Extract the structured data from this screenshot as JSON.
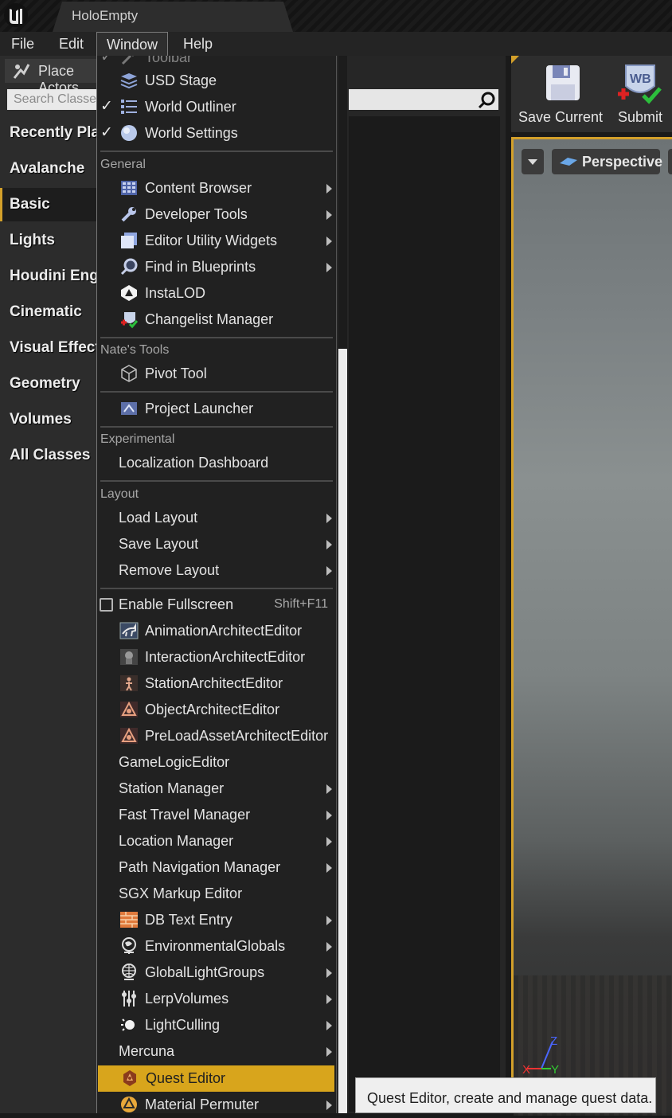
{
  "titlebar": {
    "document_tab": "HoloEmpty"
  },
  "menubar": {
    "items": [
      "File",
      "Edit",
      "Window",
      "Help"
    ]
  },
  "left_panel": {
    "tab_label": "Place Actors",
    "search_placeholder": "Search Classes",
    "categories": [
      "Recently Placed",
      "Avalanche",
      "Basic",
      "Lights",
      "Houdini Engine",
      "Cinematic",
      "Visual Effects",
      "Geometry",
      "Volumes",
      "All Classes"
    ],
    "selected": "Basic"
  },
  "toolbar": {
    "save_label": "Save Current",
    "submit_label": "Submit"
  },
  "viewport": {
    "view_mode": "Perspective",
    "axis": {
      "x": "X",
      "y": "Y",
      "z": "Z"
    }
  },
  "window_menu": {
    "top_items": [
      {
        "label": "Toolbar",
        "checked": true,
        "icon": "tools-icon"
      },
      {
        "label": "USD Stage",
        "checked": false,
        "icon": "layers-icon"
      },
      {
        "label": "World Outliner",
        "checked": true,
        "icon": "list-icon"
      },
      {
        "label": "World Settings",
        "checked": true,
        "icon": "globe-icon"
      }
    ],
    "general_header": "General",
    "general_items": [
      {
        "label": "Content Browser",
        "submenu": true,
        "icon": "grid-icon"
      },
      {
        "label": "Developer Tools",
        "submenu": true,
        "icon": "wrench-icon"
      },
      {
        "label": "Editor Utility Widgets",
        "submenu": true,
        "icon": "widget-icon"
      },
      {
        "label": "Find in Blueprints",
        "submenu": true,
        "icon": "magnifier-icon"
      },
      {
        "label": "InstaLOD",
        "submenu": false,
        "icon": "instalod-icon"
      },
      {
        "label": "Changelist Manager",
        "submenu": false,
        "icon": "changelist-icon"
      }
    ],
    "nates_header": "Nate's Tools",
    "nates_items": [
      {
        "label": "Pivot Tool",
        "icon": "cube-icon"
      }
    ],
    "launcher_item": {
      "label": "Project Launcher",
      "icon": "launcher-icon"
    },
    "experimental_header": "Experimental",
    "experimental_items": [
      {
        "label": "Localization Dashboard"
      }
    ],
    "layout_header": "Layout",
    "layout_items": [
      {
        "label": "Load Layout",
        "submenu": true
      },
      {
        "label": "Save Layout",
        "submenu": true
      },
      {
        "label": "Remove Layout",
        "submenu": true
      }
    ],
    "fullscreen": {
      "label": "Enable Fullscreen",
      "shortcut": "Shift+F11"
    },
    "custom_items": [
      {
        "label": "AnimationArchitectEditor",
        "submenu": false,
        "icon": "horse-icon"
      },
      {
        "label": "InteractionArchitectEditor",
        "submenu": false,
        "icon": "interaction-icon"
      },
      {
        "label": "StationArchitectEditor",
        "submenu": false,
        "icon": "figure-icon"
      },
      {
        "label": "ObjectArchitectEditor",
        "submenu": false,
        "icon": "object-icon"
      },
      {
        "label": "PreLoadAssetArchitectEditor",
        "submenu": false,
        "icon": "preload-icon"
      },
      {
        "label": "GameLogicEditor",
        "submenu": false,
        "icon": ""
      },
      {
        "label": "Station Manager",
        "submenu": true,
        "icon": ""
      },
      {
        "label": "Fast Travel Manager",
        "submenu": true,
        "icon": ""
      },
      {
        "label": "Location Manager",
        "submenu": true,
        "icon": ""
      },
      {
        "label": "Path Navigation Manager",
        "submenu": true,
        "icon": ""
      },
      {
        "label": "SGX Markup Editor",
        "submenu": false,
        "icon": ""
      },
      {
        "label": "DB Text Entry",
        "submenu": true,
        "icon": "brick-icon"
      },
      {
        "label": "EnvironmentalGlobals",
        "submenu": true,
        "icon": "env-globe-icon"
      },
      {
        "label": "GlobalLightGroups",
        "submenu": true,
        "icon": "light-globe-icon"
      },
      {
        "label": "LerpVolumes",
        "submenu": true,
        "icon": "sliders-icon"
      },
      {
        "label": "LightCulling",
        "submenu": true,
        "icon": "sun-icon"
      },
      {
        "label": "Mercuna",
        "submenu": true,
        "icon": ""
      },
      {
        "label": "Quest Editor",
        "submenu": false,
        "icon": "quest-icon",
        "highlighted": true
      },
      {
        "label": "Material Permuter",
        "submenu": true,
        "icon": "material-icon"
      }
    ]
  },
  "tooltip": {
    "text": "Quest Editor, create and manage quest data."
  },
  "colors": {
    "accent": "#d8a51c",
    "menu_bg": "#212121",
    "panel_bg": "#2c2c2c"
  }
}
